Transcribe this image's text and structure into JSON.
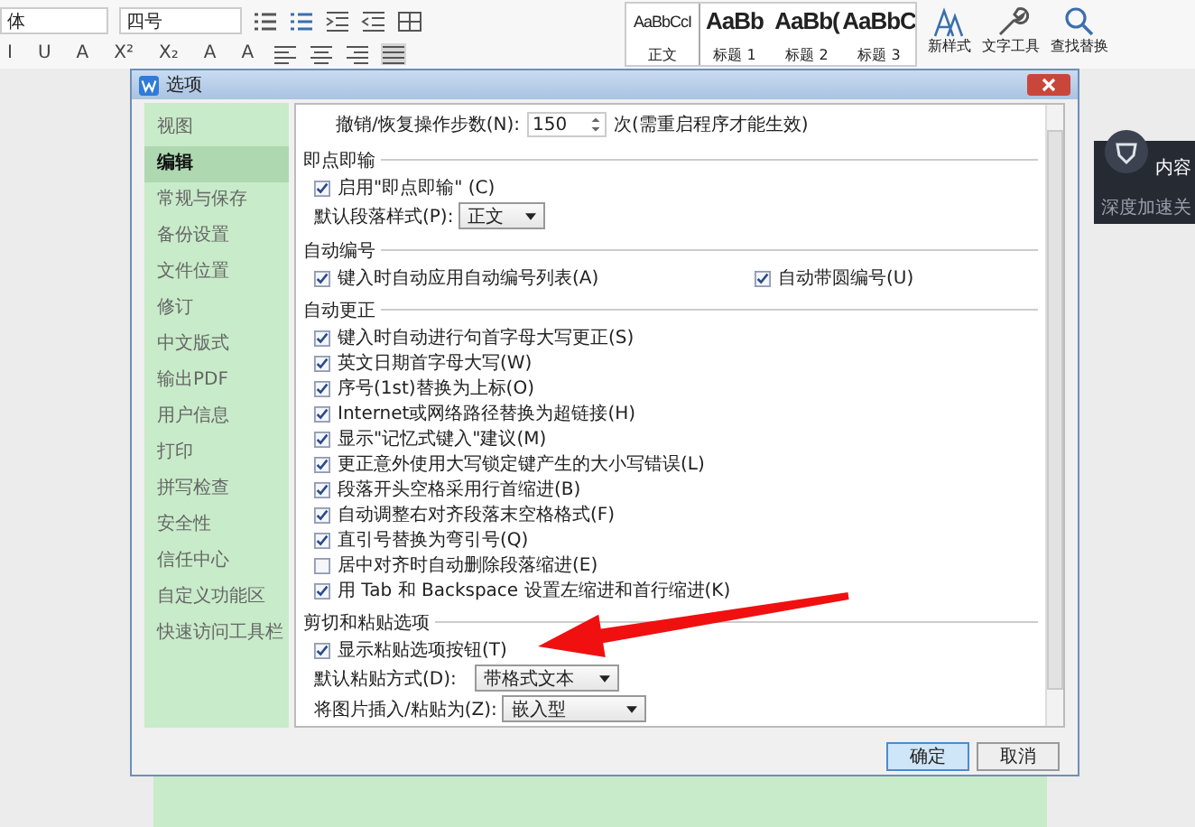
{
  "ribbon": {
    "font_field": "体",
    "size_field": "四号",
    "format_buttons": [
      "I",
      "U",
      "A",
      "X²",
      "X₂",
      "A",
      "A"
    ],
    "styles": [
      {
        "sample": "AaBbCcI",
        "label": "正文",
        "selected": true
      },
      {
        "sample": "AaBb",
        "label": "标题 1",
        "selected": false
      },
      {
        "sample": "AaBb(",
        "label": "标题 2",
        "selected": false
      },
      {
        "sample": "AaBbC",
        "label": "标题 3",
        "selected": false
      }
    ],
    "tools": [
      {
        "label": "新样式",
        "kind": "style"
      },
      {
        "label": "文字工具",
        "kind": "wrench"
      },
      {
        "label": "查找替换",
        "kind": "search"
      }
    ]
  },
  "dialog": {
    "title": "选项",
    "sidebar": [
      {
        "label": "视图",
        "selected": false
      },
      {
        "label": "编辑",
        "selected": true
      },
      {
        "label": "常规与保存",
        "selected": false
      },
      {
        "label": "备份设置",
        "selected": false
      },
      {
        "label": "文件位置",
        "selected": false
      },
      {
        "label": "修订",
        "selected": false
      },
      {
        "label": "中文版式",
        "selected": false
      },
      {
        "label": "输出PDF",
        "selected": false
      },
      {
        "label": "用户信息",
        "selected": false
      },
      {
        "label": "打印",
        "selected": false
      },
      {
        "label": "拼写检查",
        "selected": false
      },
      {
        "label": "安全性",
        "selected": false
      },
      {
        "label": "信任中心",
        "selected": false
      },
      {
        "label": "自定义功能区",
        "selected": false
      },
      {
        "label": "快速访问工具栏",
        "selected": false
      }
    ],
    "undo": {
      "label": "撤销/恢复操作步数(N):",
      "value": "150",
      "note": "次(需重启程序才能生效)"
    },
    "groups": [
      {
        "title": "即点即输",
        "items": [
          {
            "kind": "checkbox",
            "label": "启用\"即点即输\" (C)",
            "checked": true
          },
          {
            "kind": "select",
            "label": "默认段落样式(P):",
            "value": "正文"
          }
        ]
      },
      {
        "title": "自动编号",
        "items": [
          {
            "kind": "checkbox_row",
            "options": [
              {
                "label": "键入时自动应用自动编号列表(A)",
                "checked": true
              },
              {
                "label": "自动带圆编号(U)",
                "checked": true
              }
            ]
          }
        ]
      },
      {
        "title": "自动更正",
        "items": [
          {
            "kind": "checkbox",
            "label": "键入时自动进行句首字母大写更正(S)",
            "checked": true
          },
          {
            "kind": "checkbox",
            "label": "英文日期首字母大写(W)",
            "checked": true
          },
          {
            "kind": "checkbox",
            "label": "序号(1st)替换为上标(O)",
            "checked": true
          },
          {
            "kind": "checkbox",
            "label": "Internet或网络路径替换为超链接(H)",
            "checked": true
          },
          {
            "kind": "checkbox",
            "label": "显示\"记忆式键入\"建议(M)",
            "checked": true
          },
          {
            "kind": "checkbox",
            "label": "更正意外使用大写锁定键产生的大小写错误(L)",
            "checked": true
          },
          {
            "kind": "checkbox",
            "label": "段落开头空格采用行首缩进(B)",
            "checked": true
          },
          {
            "kind": "checkbox",
            "label": "自动调整右对齐段落末空格格式(F)",
            "checked": true
          },
          {
            "kind": "checkbox",
            "label": "直引号替换为弯引号(Q)",
            "checked": true
          },
          {
            "kind": "checkbox",
            "label": "居中对齐时自动删除段落缩进(E)",
            "checked": false
          },
          {
            "kind": "checkbox",
            "label": "用 Tab 和 Backspace 设置左缩进和首行缩进(K)",
            "checked": true
          }
        ]
      },
      {
        "title": "剪切和粘贴选项",
        "items": [
          {
            "kind": "checkbox",
            "label": "显示粘贴选项按钮(T)",
            "checked": true
          },
          {
            "kind": "select",
            "label": "默认粘贴方式(D):",
            "value": "带格式文本"
          },
          {
            "kind": "select",
            "label": "将图片插入/粘贴为(Z):",
            "value": "嵌入型"
          }
        ]
      }
    ],
    "buttons": [
      "确定",
      "取消"
    ]
  },
  "popup": {
    "title": "内容",
    "message": "深度加速关"
  }
}
